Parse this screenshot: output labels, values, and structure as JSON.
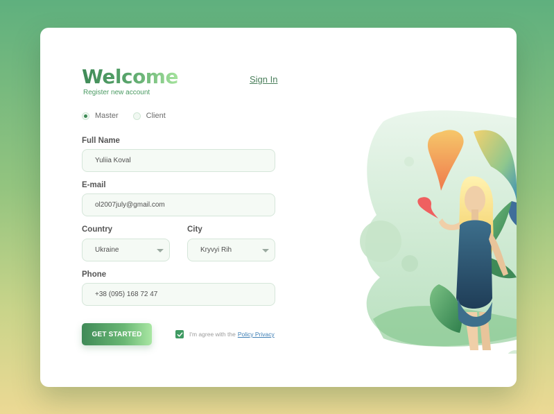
{
  "header": {
    "title": "Welcome",
    "subtitle": "Register new account",
    "sign_in_label": "Sign In"
  },
  "account_type": {
    "options": [
      {
        "label": "Master",
        "selected": true
      },
      {
        "label": "Client",
        "selected": false
      }
    ]
  },
  "form": {
    "full_name": {
      "label": "Full Name",
      "value": "Yuliia Koval"
    },
    "email": {
      "label": "E-mail",
      "value": "ol2007july@gmail.com"
    },
    "country": {
      "label": "Country",
      "value": "Ukraine"
    },
    "city": {
      "label": "City",
      "value": "Kryvyi Rih"
    },
    "phone": {
      "label": "Phone",
      "value": "+38 (095) 168 72 47"
    }
  },
  "actions": {
    "submit_label": "GET STARTED",
    "agree_text": "I'm agree with the",
    "agree_link": "Policy Privacy",
    "agree_checked": true
  },
  "colors": {
    "brand": "#3f8a57",
    "accent_light": "#a9e7a3",
    "link": "#3e7fb5"
  },
  "icons": [
    "radio-selected-icon",
    "radio-icon",
    "chevron-down-icon",
    "checkmark-icon"
  ]
}
